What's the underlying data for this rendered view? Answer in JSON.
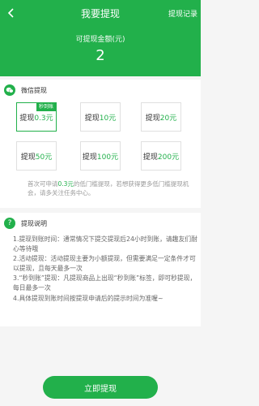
{
  "header": {
    "title": "我要提现",
    "history": "提现记录",
    "amount_label": "可提现金额(元)",
    "amount": "2"
  },
  "wechat": {
    "title": "微信提现",
    "options": [
      {
        "prefix": "提现",
        "amount": "0.3元",
        "badge": "秒到账",
        "selected": true
      },
      {
        "prefix": "提现",
        "amount": "10元"
      },
      {
        "prefix": "提现",
        "amount": "20元"
      },
      {
        "prefix": "提现",
        "amount": "50元"
      },
      {
        "prefix": "提现",
        "amount": "100元"
      },
      {
        "prefix": "提现",
        "amount": "200元"
      }
    ],
    "note": {
      "part1": "首次可申请",
      "highlight": "0.3元",
      "part2": "的低门槛提现，若想获得更多低门槛提现机会，请多关注任务中心。"
    }
  },
  "explain": {
    "title": "提现说明",
    "lines": [
      "1.提现到账时间：通常情况下提交提现后24小时到账，请趣友们耐心等待哦",
      "2.活动提现：活动提现主要为小额提现，但需要满足一定条件才可以提现，且每天最多一次",
      "3.“秒到账”提现：凡提现商品上出现“秒到账”标签，即可秒提现，每日最多一次",
      "4.具体提现到账时间按提现申请后的提示时间为准喔~"
    ]
  },
  "submit": "立即提现",
  "colors": {
    "accent": "#22b04b"
  }
}
